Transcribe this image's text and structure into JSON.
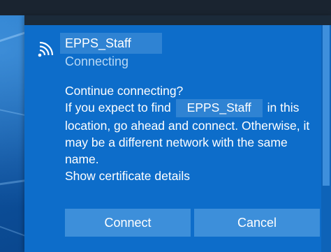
{
  "network": {
    "name": "EPPS_Staff",
    "status": "Connecting",
    "icon": "wifi-icon"
  },
  "prompt": {
    "line1": "Continue connecting?",
    "line2_before": "If you expect to find",
    "ssid": "EPPS_Staff",
    "line2_after": "in this",
    "line3": "location, go ahead and connect. Otherwise, it",
    "line4": "may be a different network with the same",
    "line5": "name.",
    "cert_link": "Show certificate details"
  },
  "buttons": {
    "connect": "Connect",
    "cancel": "Cancel"
  },
  "colors": {
    "flyout_bg": "#0d6dca",
    "button_bg": "#3d8fda",
    "status_text": "#b7d8f5"
  }
}
